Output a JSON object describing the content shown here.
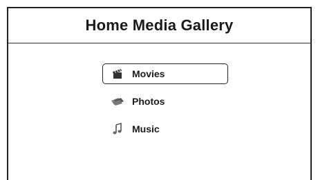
{
  "window": {
    "title": "Home Media Gallery"
  },
  "menu": {
    "items": [
      {
        "label": "Movies",
        "icon": "clapperboard-icon",
        "selected": true
      },
      {
        "label": "Photos",
        "icon": "photos-icon",
        "selected": false
      },
      {
        "label": "Music",
        "icon": "music-note-icon",
        "selected": false
      }
    ]
  },
  "colors": {
    "border": "#222222",
    "text": "#1a1a1a",
    "background": "#ffffff"
  }
}
